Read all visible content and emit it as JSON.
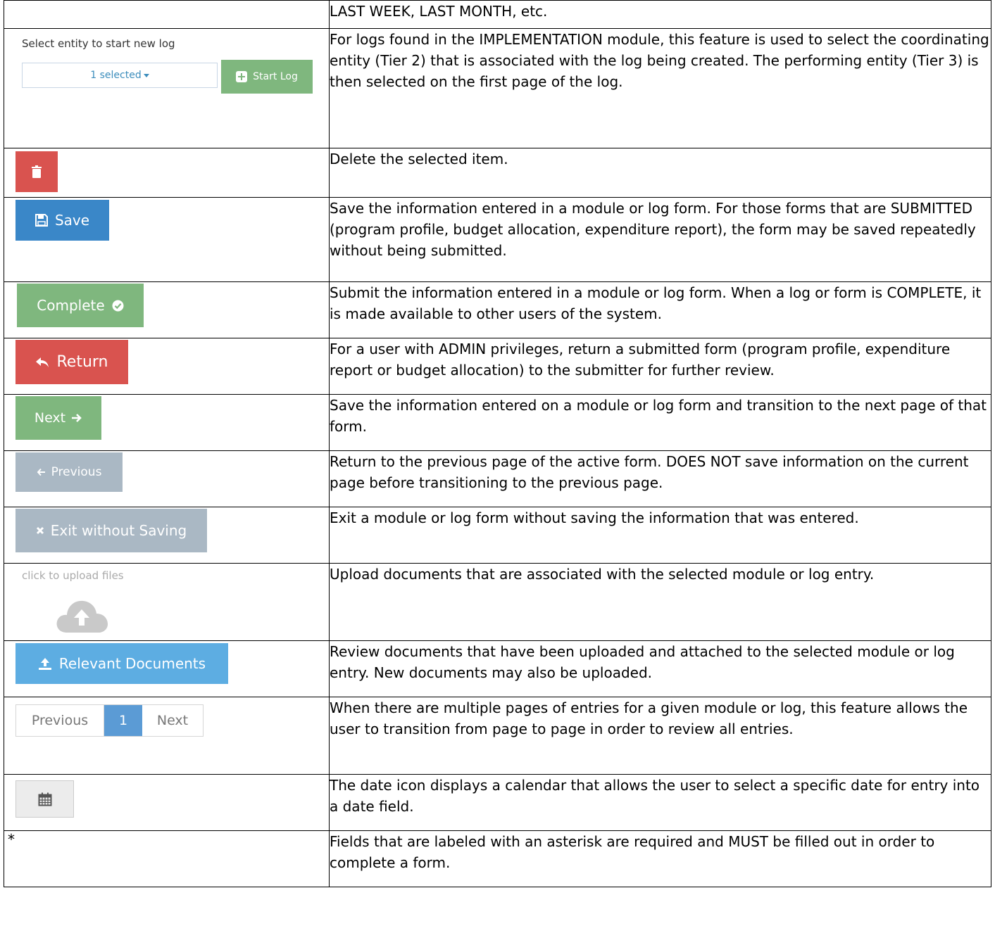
{
  "rows": [
    {
      "text": "LAST WEEK, LAST MONTH, etc."
    },
    {
      "left": {
        "label": "Select entity to start new log",
        "select_value": "1 selected",
        "button": "Start Log",
        "button_color": "#7fb77e"
      },
      "text": "For logs found in the IMPLEMENTATION module, this feature is used to select the coordinating entity (Tier 2) that is associated with the log being created. The performing entity (Tier 3) is then selected on the first page of the log."
    },
    {
      "left": {
        "icon": "trash-icon",
        "button_color": "#d9534f"
      },
      "text": "Delete the selected item."
    },
    {
      "left": {
        "icon": "floppy-disk-icon",
        "button": "Save",
        "button_color": "#3a87c8"
      },
      "text": "Save the information entered in a module or log form. For those forms that are SUBMITTED (program profile, budget allocation, expenditure report), the form may be saved repeatedly without being submitted."
    },
    {
      "left": {
        "icon": "check-circle-icon",
        "button": "Complete",
        "button_color": "#7fb77e"
      },
      "text": "Submit the information entered in a module or log form. When a log or form is COMPLETE, it is made available to other users of the system."
    },
    {
      "left": {
        "icon": "return-arrow-icon",
        "button": "Return",
        "button_color": "#d9534f"
      },
      "text": "For a user with ADMIN privileges, return a submitted form (program profile, expenditure report or budget allocation) to the submitter for further review."
    },
    {
      "left": {
        "icon": "arrow-right-icon",
        "button": "Next",
        "button_color": "#7fb77e"
      },
      "text": "Save the information entered on a module or log form and transition to the next page of that form."
    },
    {
      "left": {
        "icon": "arrow-left-icon",
        "button": "Previous",
        "button_color": "#aab8c4"
      },
      "text": "Return to the previous page of the active form. DOES NOT save information on the current page before transitioning to the previous page."
    },
    {
      "left": {
        "icon": "close-icon",
        "button": "Exit without Saving",
        "button_color": "#aab8c4"
      },
      "text": "Exit a module or log form without saving the information that was entered."
    },
    {
      "left": {
        "label": "click to upload files",
        "icon": "cloud-upload-icon"
      },
      "text": "Upload documents that are associated with the selected module or log entry."
    },
    {
      "left": {
        "icon": "upload-icon",
        "button": "Relevant Documents",
        "button_color": "#5dade2"
      },
      "text": "Review documents that have been uploaded and attached to the selected module or log entry. New documents may also be uploaded."
    },
    {
      "left": {
        "prev": "Previous",
        "page": "1",
        "next": "Next"
      },
      "text": "When there are multiple pages of entries for a given module or log, this feature allows the user to transition from page to page in order to review all entries."
    },
    {
      "left": {
        "icon": "calendar-icon"
      },
      "text": "The date icon displays a calendar that allows the user to select a specific date for entry into a date field."
    },
    {
      "left": {
        "symbol": "*"
      },
      "text": "Fields that are labeled with an asterisk are required and MUST be filled out in order to complete a form."
    }
  ]
}
